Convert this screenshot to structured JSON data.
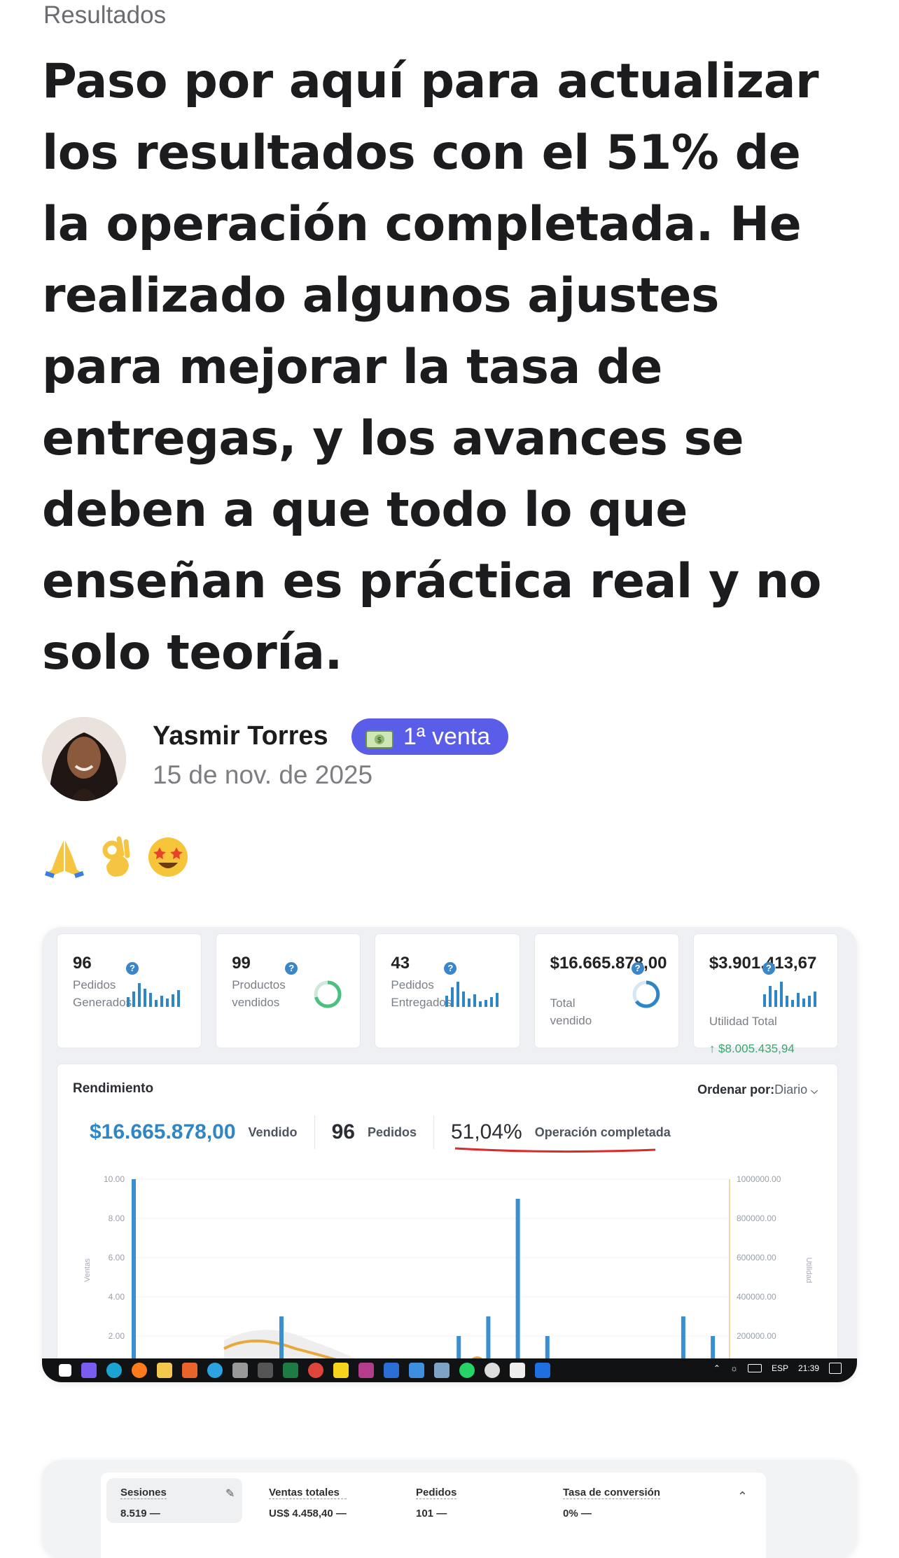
{
  "section": {
    "label": "Resultados"
  },
  "post": {
    "title": "Paso por aquí para actualizar los resultados con el 51% de la operación completada. He realizado algunos ajustes para mejorar la tasa de entregas, y los avances se deben a que todo lo que enseñan es práctica real y no solo teoría.",
    "author": {
      "name": "Yasmir Torres",
      "badge": "1ª venta",
      "badge_icon": "money-icon",
      "date": "15 de nov. de 2025"
    },
    "reactions": [
      "folded-hands-icon",
      "ok-hand-icon",
      "star-struck-icon"
    ]
  },
  "dashboard": {
    "kpis": [
      {
        "value": "96",
        "label": "Pedidos Generados",
        "chart": "bar-sparkline-icon"
      },
      {
        "value": "99",
        "label": "Productos vendidos",
        "chart": "ring-icon"
      },
      {
        "value": "43",
        "label": "Pedidos Entregados",
        "chart": "bar-sparkline-icon"
      },
      {
        "value": "$16.665.878,00",
        "label": "Total vendido",
        "chart": "ring-icon"
      },
      {
        "value": "$3.901.413,67",
        "label": "Utilidad Total",
        "chart": "bar-sparkline-icon",
        "sub": "↑ $8.005.435,94"
      }
    ],
    "panel": {
      "title": "Rendimiento",
      "sort_label": "Ordenar por:",
      "sort_value": "Diario",
      "sold_value": "$16.665.878,00",
      "sold_label": "Vendido",
      "orders_value": "96",
      "orders_label": "Pedidos",
      "completion_value": "51,04%",
      "completion_label": "Operación completada"
    },
    "chart_data": {
      "type": "bar",
      "ylabel": "Ventas",
      "y2label": "Utilidad",
      "ylim": [
        0,
        10
      ],
      "y2lim": [
        0,
        1000000
      ],
      "yticks": [
        "10.00",
        "8.00",
        "6.00",
        "4.00",
        "2.00"
      ],
      "y2ticks": [
        "1000000.00",
        "800000.00",
        "600000.00",
        "400000.00",
        "200000.00"
      ],
      "bars": [
        {
          "x": 0.0,
          "value": 10
        },
        {
          "x": 0.25,
          "value": 3
        },
        {
          "x": 0.55,
          "value": 2
        },
        {
          "x": 0.6,
          "value": 3
        },
        {
          "x": 0.65,
          "value": 9
        },
        {
          "x": 0.7,
          "value": 2
        },
        {
          "x": 0.93,
          "value": 3
        },
        {
          "x": 0.98,
          "value": 2
        }
      ]
    },
    "taskbar": {
      "lang": "ESP",
      "time": "21:39"
    }
  },
  "second_card": {
    "stats": [
      {
        "label": "Sesiones",
        "value": "8.519 —"
      },
      {
        "label": "Ventas totales",
        "value": "US$ 4.458,40 —"
      },
      {
        "label": "Pedidos",
        "value": "101 —"
      },
      {
        "label": "Tasa de conversión",
        "value": "0% —"
      }
    ]
  },
  "colors": {
    "badge": "#5a5de8",
    "accent_blue": "#2f86c5",
    "curve": "#e8a93c",
    "underline": "#d92b2b"
  }
}
